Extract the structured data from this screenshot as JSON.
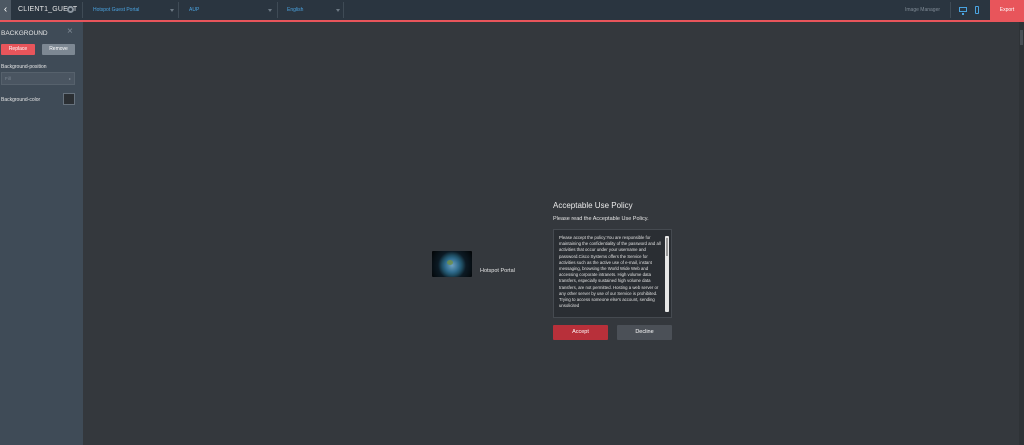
{
  "topbar": {
    "back_icon": "chevron-left-icon",
    "site_name": "CLIENT1_GUEST",
    "portal_select": "Hotspot Guest Portal",
    "page_select": "AUP",
    "language_select": "English",
    "image_manager": "Image Manager",
    "export": "Export"
  },
  "sidebar": {
    "title": "BACKGROUND",
    "replace": "Replace",
    "remove": "Remove",
    "bg_position_label": "Background-position",
    "bg_position_value": "Fill",
    "bg_color_label": "Background-color",
    "bg_color_value": "#2b2f33"
  },
  "preview": {
    "portal_name": "Hotspot Portal",
    "aup_title": "Acceptable Use Policy",
    "aup_subtitle": "Please read the Acceptable Use Policy.",
    "aup_text": "Please accept the policy:You are responsible for maintaining the confidentiality of the password and all activities that occur under your username and password.Cisco Systems offers the Service for activities such as the active use of e-mail, instant messaging, browsing the World Wide Web and accessing corporate intranets. High volume data transfers, especially sustained high volume data transfers, are not permitted. Hosting a web server or any other server by use of our Service is prohibited. Trying to access someone else's account, sending unsolicited",
    "accept": "Accept",
    "decline": "Decline"
  },
  "colors": {
    "accent": "#e8555b",
    "link": "#4aa3e0",
    "canvas": "#34383d",
    "accept": "#b8303a"
  }
}
